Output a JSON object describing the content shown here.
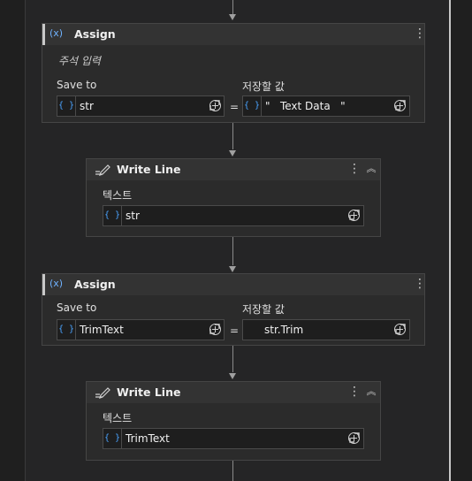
{
  "activities": [
    {
      "title": "Assign",
      "icon": "(x)",
      "comment": "주석 입력",
      "save_label": "Save to",
      "value_label": "저장할 값",
      "save_value": "str",
      "value_value": "\"   Text Data   \"",
      "brace": "{ }",
      "equals": "="
    },
    {
      "title": "Write Line",
      "text_label": "텍스트",
      "text_value": "str",
      "brace": "{ }"
    },
    {
      "title": "Assign",
      "icon": "(x)",
      "save_label": "Save to",
      "value_label": "저장할 값",
      "save_value": "TrimText",
      "value_value": "str.Trim",
      "brace": "{ }",
      "equals": "="
    },
    {
      "title": "Write Line",
      "text_label": "텍스트",
      "text_value": "TrimText",
      "brace": "{ }"
    }
  ],
  "ui": {
    "menu_glyph": "⋮",
    "collapse_glyph": "︽"
  },
  "icons": {
    "assign": "variable-icon",
    "write_line": "write-line-icon",
    "expand": "expand-icon",
    "add": "plus-circle-icon",
    "more": "more-options-icon"
  },
  "colors": {
    "canvas": "#252526",
    "card": "#2b2b2b",
    "header": "#333333",
    "accent": "#4aa3ff"
  }
}
